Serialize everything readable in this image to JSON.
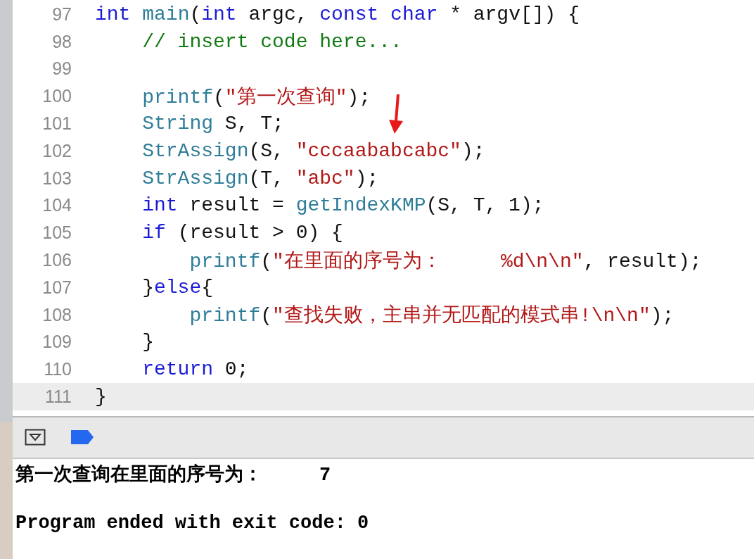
{
  "editor": {
    "lines": [
      {
        "number": "97",
        "current": false,
        "tokens": [
          {
            "kind": "keyword",
            "text": "int"
          },
          {
            "kind": "func",
            "text": " main"
          },
          {
            "kind": "plain",
            "text": "("
          },
          {
            "kind": "keyword",
            "text": "int"
          },
          {
            "kind": "plain",
            "text": " argc, "
          },
          {
            "kind": "keyword",
            "text": "const char"
          },
          {
            "kind": "plain",
            "text": " * argv[]) {"
          }
        ]
      },
      {
        "number": "98",
        "current": false,
        "tokens": [
          {
            "kind": "comment",
            "text": "    // insert code here..."
          }
        ]
      },
      {
        "number": "99",
        "current": false
      },
      {
        "number": "100",
        "current": false,
        "tokens": [
          {
            "kind": "func",
            "text": "    printf"
          },
          {
            "kind": "plain",
            "text": "("
          },
          {
            "kind": "string",
            "text": "\"第一次查询\""
          },
          {
            "kind": "plain",
            "text": ");"
          }
        ]
      },
      {
        "number": "101",
        "current": false,
        "tokens": [
          {
            "kind": "func",
            "text": "    String"
          },
          {
            "kind": "plain",
            "text": " S, T;"
          }
        ]
      },
      {
        "number": "102",
        "current": false,
        "tokens": [
          {
            "kind": "func",
            "text": "    StrAssign"
          },
          {
            "kind": "plain",
            "text": "(S, "
          },
          {
            "kind": "string",
            "text": "\"cccaababcabc\""
          },
          {
            "kind": "plain",
            "text": ");"
          }
        ]
      },
      {
        "number": "103",
        "current": false,
        "tokens": [
          {
            "kind": "func",
            "text": "    StrAssign"
          },
          {
            "kind": "plain",
            "text": "(T, "
          },
          {
            "kind": "string",
            "text": "\"abc\""
          },
          {
            "kind": "plain",
            "text": ");"
          }
        ]
      },
      {
        "number": "104",
        "current": false,
        "tokens": [
          {
            "kind": "keyword",
            "text": "    int"
          },
          {
            "kind": "plain",
            "text": " result = "
          },
          {
            "kind": "func",
            "text": "getIndexKMP"
          },
          {
            "kind": "plain",
            "text": "(S, T, 1);"
          }
        ]
      },
      {
        "number": "105",
        "current": false,
        "tokens": [
          {
            "kind": "keyword",
            "text": "    if"
          },
          {
            "kind": "plain",
            "text": " (result > 0) {"
          }
        ]
      },
      {
        "number": "106",
        "current": false,
        "tokens": [
          {
            "kind": "func",
            "text": "        printf"
          },
          {
            "kind": "plain",
            "text": "("
          },
          {
            "kind": "string",
            "text": "\"在里面的序号为：     %d\\n\\n\""
          },
          {
            "kind": "plain",
            "text": ", result);"
          }
        ]
      },
      {
        "number": "107",
        "current": false,
        "tokens": [
          {
            "kind": "plain",
            "text": "    }"
          },
          {
            "kind": "keyword",
            "text": "else"
          },
          {
            "kind": "plain",
            "text": "{"
          }
        ]
      },
      {
        "number": "108",
        "current": false,
        "tokens": [
          {
            "kind": "func",
            "text": "        printf"
          },
          {
            "kind": "plain",
            "text": "("
          },
          {
            "kind": "string",
            "text": "\"查找失败，主串并无匹配的模式串!\\n\\n\""
          },
          {
            "kind": "plain",
            "text": ");"
          }
        ]
      },
      {
        "number": "109",
        "current": false,
        "tokens": [
          {
            "kind": "plain",
            "text": "    }"
          }
        ]
      },
      {
        "number": "110",
        "current": false,
        "tokens": [
          {
            "kind": "keyword",
            "text": "    return"
          },
          {
            "kind": "plain",
            "text": " 0;"
          }
        ]
      },
      {
        "number": "111",
        "current": true,
        "tokens": [
          {
            "kind": "plain",
            "text": "}"
          }
        ]
      }
    ]
  },
  "console": {
    "lines": [
      "第一次查询在里面的序号为：     7",
      "Program ended with exit code: 0"
    ]
  }
}
